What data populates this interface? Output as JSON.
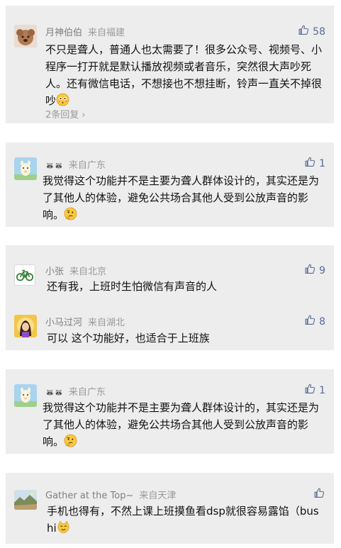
{
  "comments": [
    {
      "name": "月神伯伯",
      "location": "来自福建",
      "likes": "58",
      "text": "不只是聋人，普通人也太需要了！很多公众号、视频号、小程序一打开就是默认播放视频或者音乐，突然很大声吵死人。还有微信电话，不想接也不想挂断，铃声一直关不掉很吵",
      "emoji": "flushed-face-emoji",
      "replies": "2条回复",
      "avatar": "dog-avatar"
    },
    {
      "name": "🦝🦝",
      "location": "来自广东",
      "likes": "1",
      "text": "我觉得这个功能并不是主要为聋人群体设计的，其实还是为了其他人的体验，避免公共场合其他人受到公放声音的影响。",
      "emoji": "thinking-face-emoji",
      "avatar": "alpaca-avatar"
    },
    {
      "name": "小张",
      "location": "来自北京",
      "likes": "9",
      "text": "还有我，上班时生怕微信有声音的人",
      "avatar": "bicycle-avatar"
    },
    {
      "name": "小马过河",
      "location": "来自湖北",
      "likes": "8",
      "text": "可以 这个功能好，也适合于上班族",
      "avatar": "girl-avatar"
    },
    {
      "name": "🦝🦝",
      "location": "来自广东",
      "likes": "1",
      "text": "我觉得这个功能并不是主要为聋人群体设计的，其实还是为了其他人的体验，避免公共场合其他人受到公放声音的影响。",
      "emoji": "thinking-face-emoji",
      "avatar": "alpaca-avatar"
    },
    {
      "name": "Gather at the Top~",
      "location": "来自天津",
      "likes": "",
      "text": "手机也得有，不然上课上班摸鱼看dsp就很容易露馅（bushi",
      "emoji": "cat-face-emoji",
      "avatar": "landscape-avatar"
    }
  ],
  "colors": {
    "card_bg": "#ededed",
    "like": "#576b95",
    "meta": "#7f7f7f"
  }
}
